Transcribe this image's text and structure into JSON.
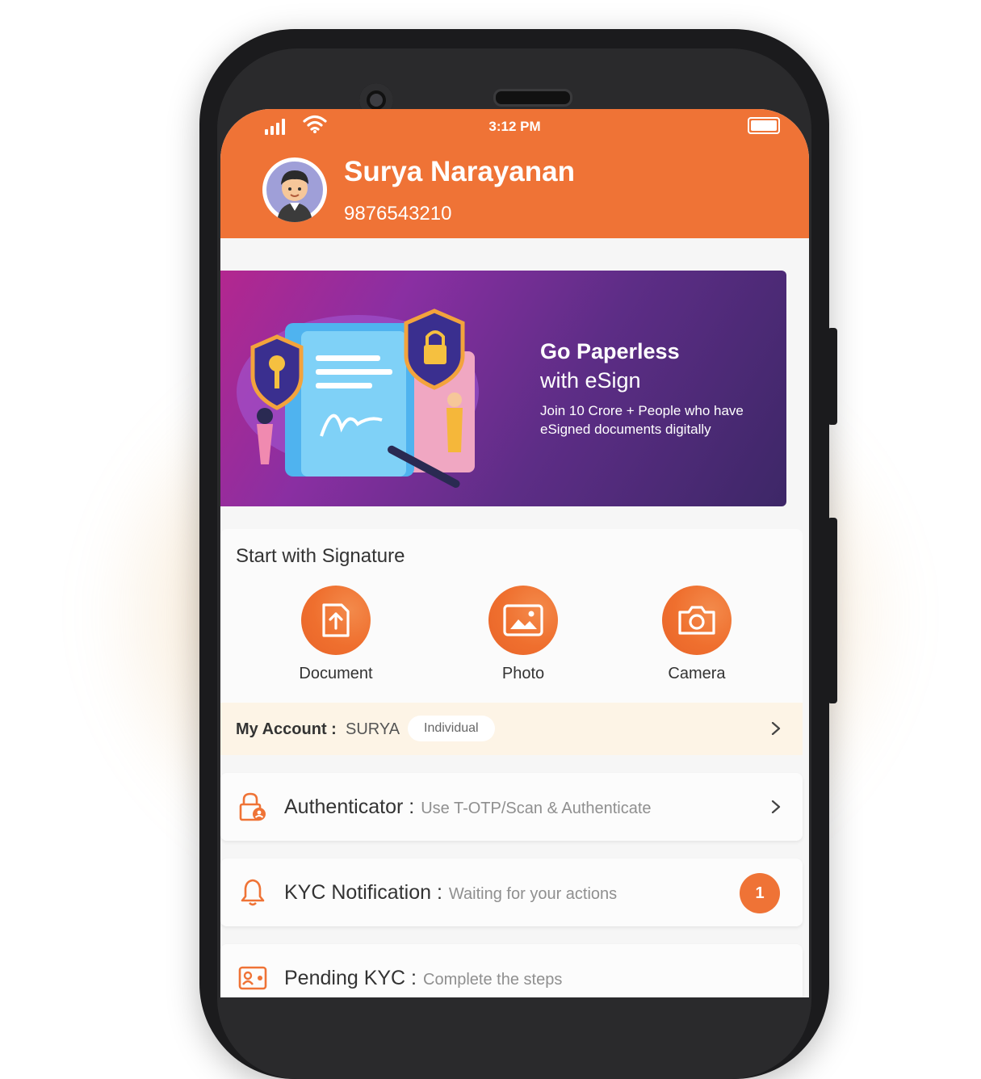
{
  "status_bar": {
    "time": "3:12 PM"
  },
  "profile": {
    "name": "Surya Narayanan",
    "phone": "9876543210"
  },
  "banner": {
    "title_line1": "Go Paperless",
    "title_line2": "with eSign",
    "subtitle_line1": "Join 10 Crore +  People  who have",
    "subtitle_line2": "eSigned documents digitally"
  },
  "signature": {
    "title": "Start with Signature",
    "actions": [
      {
        "label": "Document",
        "icon": "document-upload-icon"
      },
      {
        "label": "Photo",
        "icon": "photo-icon"
      },
      {
        "label": "Camera",
        "icon": "camera-icon"
      }
    ]
  },
  "account": {
    "label": "My Account :",
    "value": "SURYA",
    "badge": "Individual"
  },
  "menu": [
    {
      "label": "Authenticator :",
      "desc": "Use T-OTP/Scan & Authenticate",
      "icon": "lock-user-icon"
    },
    {
      "label": "KYC Notification :",
      "desc": "Waiting for your actions",
      "icon": "bell-icon",
      "badge": "1"
    },
    {
      "label": "Pending KYC :",
      "desc": "Complete the steps",
      "icon": "id-card-icon"
    }
  ],
  "colors": {
    "accent": "#ef7336",
    "banner_start": "#b3278f",
    "banner_end": "#3d2767",
    "account_bg": "#fdf4e6"
  }
}
